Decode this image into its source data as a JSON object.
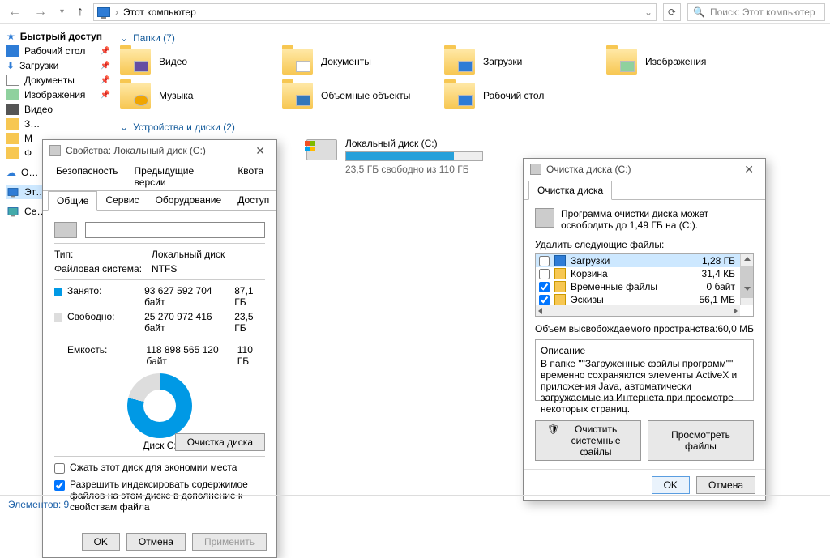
{
  "toolbar": {
    "breadcrumb": "Этот компьютер",
    "search_placeholder": "Поиск: Этот компьютер"
  },
  "sidebar": {
    "quick": "Быстрый доступ",
    "desktop": "Рабочий стол",
    "downloads": "Загрузки",
    "documents": "Документы",
    "pictures": "Изображения",
    "video": "Видео",
    "trunc1": "З…",
    "trunc2": "М",
    "trunc3": "Ф",
    "onedrive": "O…",
    "thispc": "Эт…",
    "network": "Се…"
  },
  "sections": {
    "folders": "Папки (7)",
    "drives": "Устройства и диски (2)"
  },
  "folders": [
    {
      "label": "Видео"
    },
    {
      "label": "Документы"
    },
    {
      "label": "Загрузки"
    },
    {
      "label": "Изображения"
    },
    {
      "label": "Музыка"
    },
    {
      "label": "Объемные объекты"
    },
    {
      "label": "Рабочий стол"
    }
  ],
  "drive": {
    "name": "Локальный диск (C:)",
    "free": "23,5 ГБ свободно из 110 ГБ",
    "fill_pct": 79
  },
  "props": {
    "title": "Свойства: Локальный диск (C:)",
    "tabs_row1": [
      "Безопасность",
      "Предыдущие версии",
      "Квота"
    ],
    "tabs_row2": [
      "Общие",
      "Сервис",
      "Оборудование",
      "Доступ"
    ],
    "type_lab": "Тип:",
    "type_val": "Локальный диск",
    "fs_lab": "Файловая система:",
    "fs_val": "NTFS",
    "used_lab": "Занято:",
    "used_bytes": "93 627 592 704 байт",
    "used_gb": "87,1 ГБ",
    "free_lab": "Свободно:",
    "free_bytes": "25 270 972 416 байт",
    "free_gb": "23,5 ГБ",
    "cap_lab": "Емкость:",
    "cap_bytes": "118 898 565 120 байт",
    "cap_gb": "110 ГБ",
    "disk_caption": "Диск C:",
    "cleanup_btn": "Очистка диска",
    "compress": "Сжать этот диск для экономии места",
    "index": "Разрешить индексировать содержимое файлов на этом диске в дополнение к свойствам файла",
    "ok": "OK",
    "cancel": "Отмена",
    "apply": "Применить"
  },
  "cleanup": {
    "title": "Очистка диска  (C:)",
    "tab": "Очистка диска",
    "intro": "Программа очистки диска может освободить до 1,49 ГБ на  (C:).",
    "delete_hdr": "Удалить следующие файлы:",
    "files": [
      {
        "checked": false,
        "name": "Загрузки",
        "size": "1,28 ГБ"
      },
      {
        "checked": false,
        "name": "Корзина",
        "size": "31,4 КБ"
      },
      {
        "checked": true,
        "name": "Временные файлы",
        "size": "0 байт"
      },
      {
        "checked": true,
        "name": "Эскизы",
        "size": "56,1 МБ"
      }
    ],
    "freed_lab": "Объем высвобождаемого пространства:",
    "freed_val": "60,0 МБ",
    "desc_hdr": "Описание",
    "desc_body": "В папке \"\"Загруженные файлы программ\"\" временно сохраняются элементы ActiveX и приложения Java, автоматически загружаемые из Интернета при просмотре некоторых страниц.",
    "sys_btn": "Очистить системные файлы",
    "view_btn": "Просмотреть файлы",
    "ok": "OK",
    "cancel": "Отмена"
  },
  "status": "Элементов: 9",
  "chart_data": {
    "type": "pie",
    "title": "Диск C:",
    "series": [
      {
        "name": "Занято",
        "value": 93627592704,
        "display": "87,1 ГБ",
        "color": "#0099e5"
      },
      {
        "name": "Свободно",
        "value": 25270972416,
        "display": "23,5 ГБ",
        "color": "#dddddd"
      }
    ],
    "total": {
      "label": "Емкость",
      "value": 118898565120,
      "display": "110 ГБ"
    }
  }
}
